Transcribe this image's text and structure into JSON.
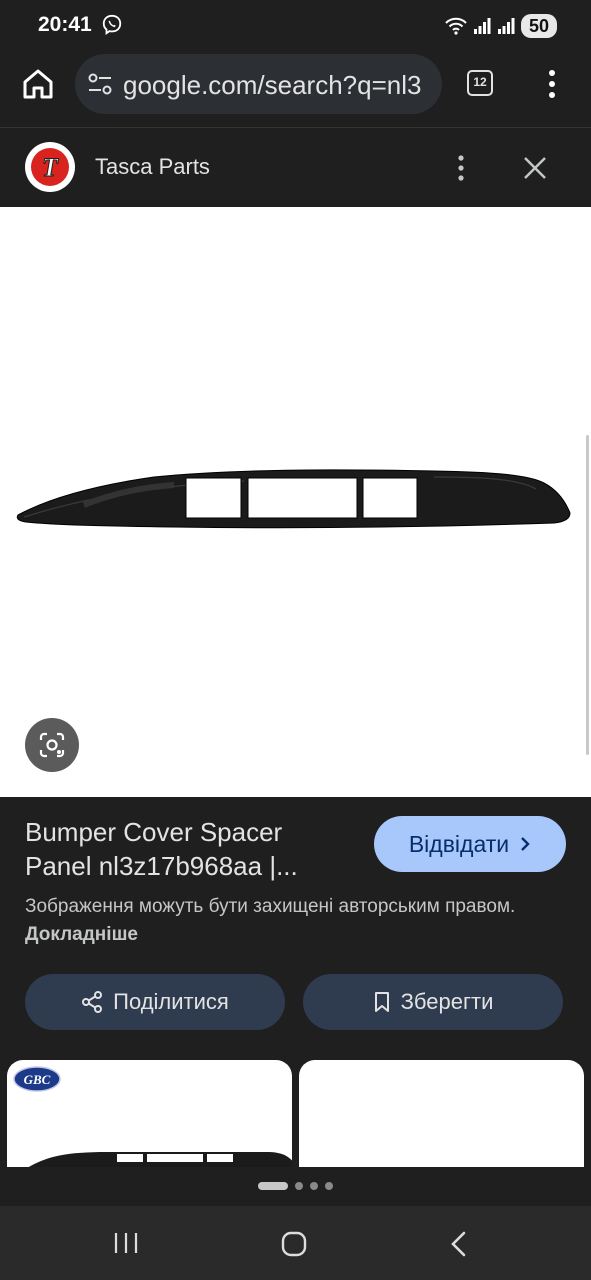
{
  "status": {
    "time": "20:41",
    "battery": "50"
  },
  "browser": {
    "url": "google.com/search?q=nl3",
    "tab_count": "12"
  },
  "source": {
    "name": "Tasca Parts",
    "logo_letter": "T"
  },
  "result": {
    "title": "Bumper Cover Spacer Panel nl3z17b968aa |...",
    "visit_label": "Відвідати",
    "copyright_text": "Зображення можуть бути захищені авторським правом.",
    "learn_more": "Докладніше",
    "share_label": "Поділитися",
    "save_label": "Зберегти"
  },
  "related": {
    "thumb1_logo": "GBC"
  },
  "pager": {
    "pages": 4,
    "active_index": 0
  },
  "colors": {
    "accent": "#a8c7fa",
    "panel": "#1f1f1f",
    "button": "#2f3b4e"
  }
}
